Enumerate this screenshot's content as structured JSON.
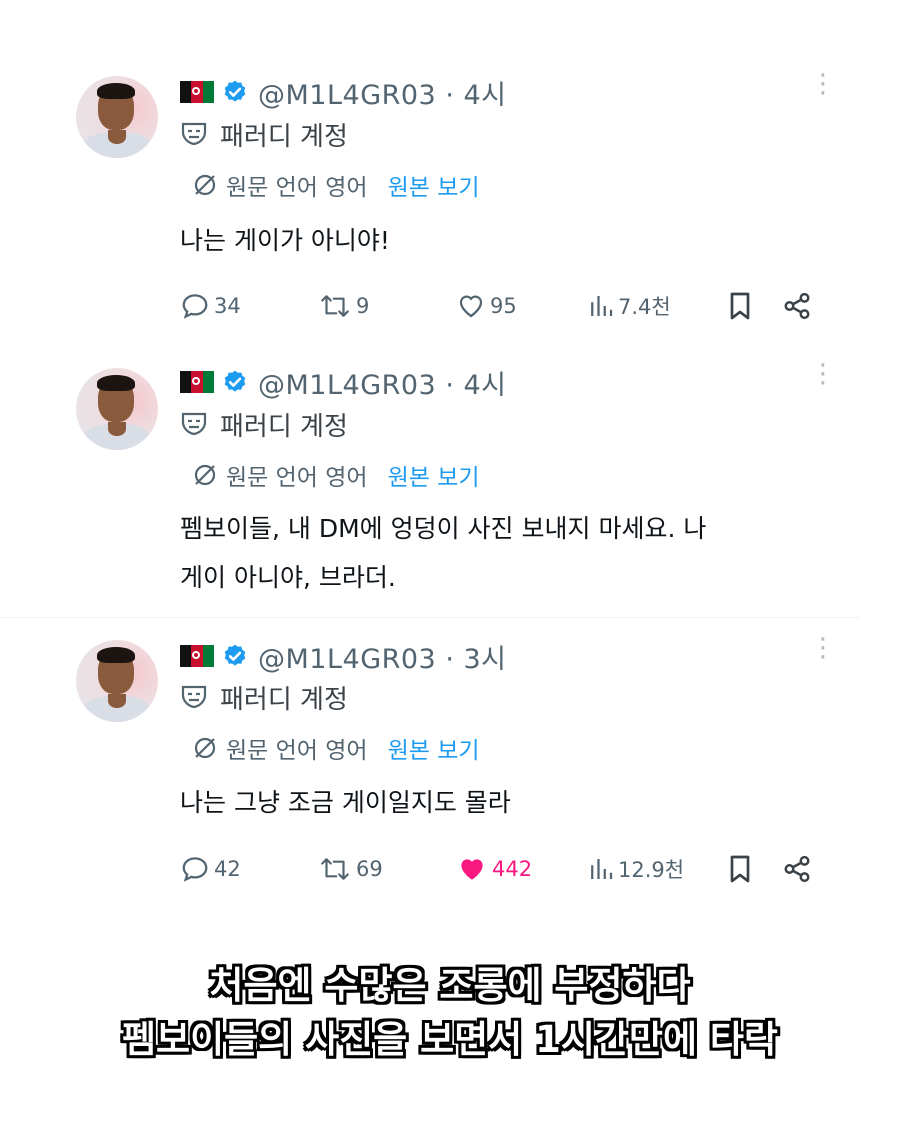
{
  "tweets": [
    {
      "handle": "@M1L4GR03 · 4시",
      "label": "패러디 계정",
      "source_language": "원문 언어 영어",
      "show_original": "원본 보기",
      "text": "나는 게이가 아니야!",
      "stats": {
        "replies": "34",
        "reposts": "9",
        "likes": "95",
        "views": "7.4천"
      },
      "liked": false
    },
    {
      "handle": "@M1L4GR03 · 4시",
      "label": "패러디 계정",
      "source_language": "원문 언어 영어",
      "show_original": "원본 보기",
      "text_lines": [
        "펨보이들, 내 DM에 엉덩이 사진 보내지 마세요. 나",
        "게이 아니야, 브라더."
      ]
    },
    {
      "handle": "@M1L4GR03 · 3시",
      "label": "패러디 계정",
      "source_language": "원문 언어 영어",
      "show_original": "원본 보기",
      "text": "나는 그냥 조금 게이일지도 몰라",
      "stats": {
        "replies": "42",
        "reposts": "69",
        "likes": "442",
        "views": "12.9천"
      },
      "liked": true
    }
  ],
  "caption": {
    "line1": "처음엔 수많은 조롱에 부정하다",
    "line2": "펨보이들의 사진을 보면서 1시간만에 타락"
  },
  "icons": {
    "flag": "afghanistan-flag-icon",
    "verified": "verified-badge-icon",
    "parody": "parody-mask-icon",
    "translate": "globe-slash-icon",
    "reply": "reply-icon",
    "repost": "repost-icon",
    "like": "heart-icon",
    "views": "views-chart-icon",
    "bookmark": "bookmark-icon",
    "share": "share-icon"
  },
  "colors": {
    "link": "#1d9bf0",
    "verified": "#1d9bf0",
    "liked": "#f91880",
    "muted": "#536471"
  }
}
